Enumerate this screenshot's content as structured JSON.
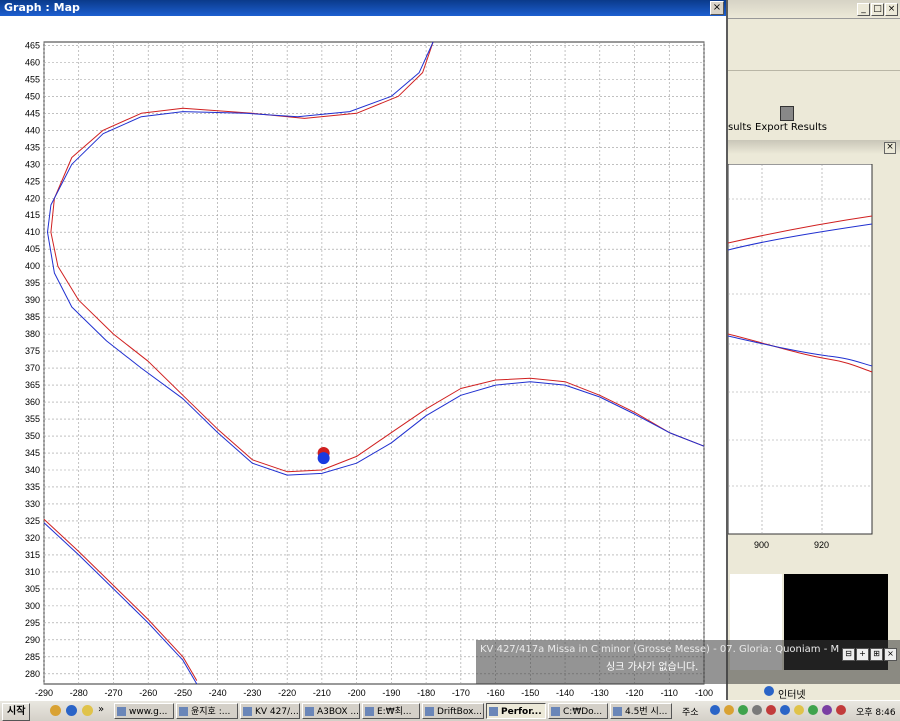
{
  "map_window": {
    "title": "Graph : Map",
    "close_label": "×"
  },
  "right_top": {
    "buttons": [
      "_",
      "□",
      "×"
    ],
    "results_label": "sults",
    "export_label": "Export Results"
  },
  "right_mid": {
    "close_label": "×",
    "x_ticks": [
      "900",
      "920"
    ]
  },
  "chart_data": {
    "type": "line",
    "title": "",
    "xlabel": "",
    "ylabel": "",
    "xlim": [
      -290,
      -100
    ],
    "ylim": [
      277,
      466
    ],
    "x_ticks": [
      -290,
      -280,
      -270,
      -260,
      -250,
      -240,
      -230,
      -220,
      -210,
      -200,
      -190,
      -180,
      -170,
      -160,
      -150,
      -140,
      -130,
      -120,
      -110,
      -100
    ],
    "y_ticks": [
      280,
      285,
      290,
      295,
      300,
      305,
      310,
      315,
      320,
      325,
      330,
      335,
      340,
      345,
      350,
      355,
      360,
      365,
      370,
      375,
      380,
      385,
      390,
      395,
      400,
      405,
      410,
      415,
      420,
      425,
      430,
      435,
      440,
      445,
      450,
      455,
      460,
      465
    ],
    "grid": true,
    "series": [
      {
        "color": "#d02020",
        "points": [
          [
            -178,
            466
          ],
          [
            -181,
            457
          ],
          [
            -188,
            450
          ],
          [
            -200,
            445
          ],
          [
            -215,
            443.5
          ],
          [
            -230,
            445
          ],
          [
            -250,
            446.5
          ],
          [
            -262,
            445
          ],
          [
            -273,
            440
          ],
          [
            -282,
            432
          ],
          [
            -287,
            420
          ],
          [
            -288,
            410
          ],
          [
            -286,
            400
          ],
          [
            -280,
            390
          ],
          [
            -270,
            380
          ],
          [
            -260,
            372
          ],
          [
            -250,
            362
          ],
          [
            -240,
            352
          ],
          [
            -230,
            343
          ],
          [
            -220,
            339.5
          ],
          [
            -210,
            340
          ],
          [
            -200,
            344
          ],
          [
            -190,
            351
          ],
          [
            -180,
            358
          ],
          [
            -170,
            364
          ],
          [
            -160,
            366.5
          ],
          [
            -150,
            367
          ],
          [
            -140,
            366
          ],
          [
            -130,
            362
          ],
          [
            -120,
            357
          ],
          [
            -110,
            351
          ],
          [
            -100,
            347
          ]
        ]
      },
      {
        "color": "#2030d0",
        "points": [
          [
            -178,
            466
          ],
          [
            -182,
            457
          ],
          [
            -190,
            450
          ],
          [
            -202,
            445.5
          ],
          [
            -217,
            444
          ],
          [
            -232,
            445
          ],
          [
            -250,
            445.5
          ],
          [
            -262,
            444
          ],
          [
            -273,
            439
          ],
          [
            -282,
            430
          ],
          [
            -288,
            418
          ],
          [
            -289,
            410
          ],
          [
            -287,
            398
          ],
          [
            -282,
            388
          ],
          [
            -272,
            378
          ],
          [
            -262,
            370
          ],
          [
            -250,
            361
          ],
          [
            -240,
            351
          ],
          [
            -230,
            342
          ],
          [
            -220,
            338.5
          ],
          [
            -210,
            339
          ],
          [
            -200,
            342
          ],
          [
            -190,
            348
          ],
          [
            -180,
            356
          ],
          [
            -170,
            362
          ],
          [
            -160,
            365
          ],
          [
            -150,
            366
          ],
          [
            -140,
            365
          ],
          [
            -130,
            361.5
          ],
          [
            -120,
            356.5
          ],
          [
            -110,
            351
          ],
          [
            -100,
            347
          ]
        ]
      },
      {
        "color": "#d02020",
        "points": [
          [
            -290,
            325.5
          ],
          [
            -280,
            316
          ],
          [
            -270,
            306
          ],
          [
            -260,
            296
          ],
          [
            -250,
            285
          ],
          [
            -246,
            278
          ]
        ]
      },
      {
        "color": "#2030d0",
        "points": [
          [
            -290,
            324.5
          ],
          [
            -280,
            315
          ],
          [
            -270,
            305
          ],
          [
            -260,
            295
          ],
          [
            -250,
            284
          ],
          [
            -246,
            277
          ]
        ]
      }
    ],
    "markers": [
      {
        "color": "#d02020",
        "x": -209.5,
        "y": 345
      },
      {
        "color": "#1a3ae0",
        "x": -209.5,
        "y": 343.5
      }
    ]
  },
  "media_overlay": {
    "track_title": "KV 427/417a Missa in C minor (Grosse Messe) - 07. Gloria: Quoniam - M...",
    "lyrics_status": "싱크 가사가 없습니다.",
    "buttons": [
      "⊟",
      "+",
      "⊞",
      "×"
    ]
  },
  "taskbar": {
    "start_label": "시작",
    "more_label": "»",
    "tasks": [
      {
        "label": "www.g...",
        "active": false
      },
      {
        "label": "윤지호 :...",
        "active": false
      },
      {
        "label": "KV 427/...",
        "active": false
      },
      {
        "label": "A3BOX ...",
        "active": false
      },
      {
        "label": "E:₩최...",
        "active": false
      },
      {
        "label": "DriftBox...",
        "active": false
      },
      {
        "label": "Perfor...",
        "active": true
      },
      {
        "label": "C:₩Do...",
        "active": false
      },
      {
        "label": "4.5번 시...",
        "active": false
      }
    ],
    "address_label": "주소",
    "internet_label": "인터넷",
    "clock": "오후 8:46"
  }
}
